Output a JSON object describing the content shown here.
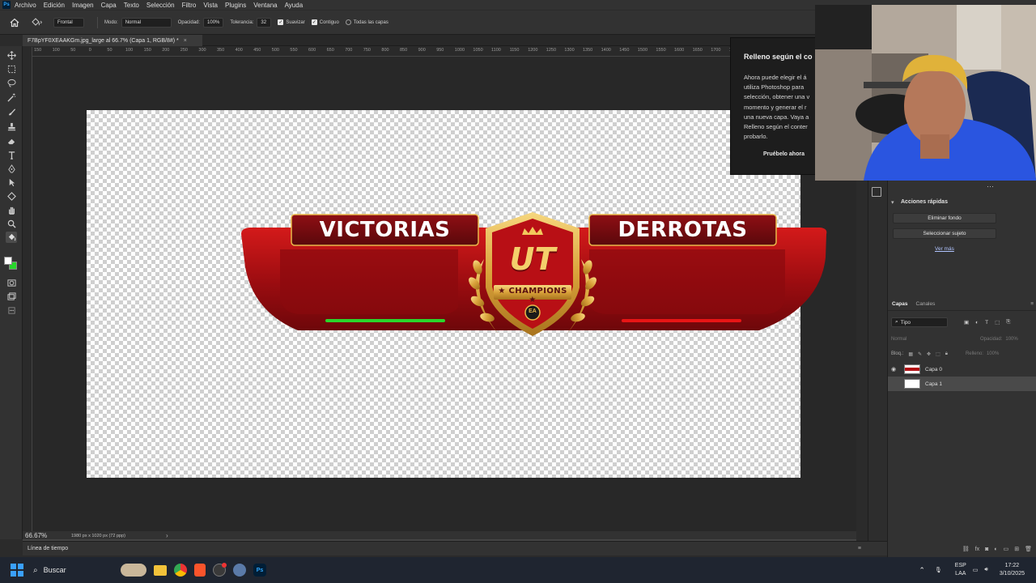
{
  "menubar": {
    "app_logo": "Ps",
    "items": [
      "Archivo",
      "Edición",
      "Imagen",
      "Capa",
      "Texto",
      "Selección",
      "Filtro",
      "Vista",
      "Plugins",
      "Ventana",
      "Ayuda"
    ]
  },
  "options": {
    "preset": "Frontal",
    "mode_label": "Modo:",
    "mode_value": "Normal",
    "opacity_label": "Opacidad:",
    "opacity_value": "100%",
    "tolerance_label": "Tolerancia:",
    "tolerance_value": "32",
    "antialias_label": "Suavizar",
    "contiguous_label": "Contiguo",
    "all_layers_label": "Todas las capas"
  },
  "document": {
    "tab_title": "F7BpYF0XEAAKGm.jpg_large al 66.7% (Capa 1, RGB/8#) *",
    "zoom": "66.67%",
    "info": "1980 px x 1020 px (72 ppp)"
  },
  "ruler": {
    "labels": [
      "150",
      "100",
      "50",
      "0",
      "50",
      "100",
      "150",
      "200",
      "250",
      "300",
      "350",
      "400",
      "450",
      "500",
      "550",
      "600",
      "650",
      "700",
      "750",
      "800",
      "850",
      "900",
      "950",
      "1000",
      "1050",
      "1100",
      "1150",
      "1200",
      "1250",
      "1300",
      "1350",
      "1400",
      "1450",
      "1500",
      "1550",
      "1600",
      "1650",
      "1700",
      "1750"
    ]
  },
  "artwork": {
    "left_label": "VICTORIAS",
    "right_label": "DERROTAS",
    "emblem_text": "UT",
    "emblem_subtext": "★ CHAMPIONS ★",
    "badge": "EA",
    "colors": {
      "red": "#b30f14",
      "gold": "#e8b84a",
      "green": "#2bd62b"
    }
  },
  "popup": {
    "title": "Relleno según el co",
    "lines": [
      "Ahora puede elegir el á",
      "utiliza Photoshop para",
      "selección, obtener una v",
      "momento y generar el r",
      "una nueva capa. Vaya a",
      "Relleno según el conter",
      "probarlo."
    ],
    "try_now": "Pruébelo ahora",
    "extra": "("
  },
  "quick_actions": {
    "title": "Acciones rápidas",
    "remove_bg": "Eliminar fondo",
    "select_subject": "Seleccionar sujeto",
    "see_more": "Ver más"
  },
  "layers_panel": {
    "tabs": [
      "Capas",
      "Canales"
    ],
    "filter_value": "Tipo",
    "blend_mode": "Normal",
    "opacity_label": "Opacidad:",
    "opacity_value": "100%",
    "lock_label": "Bloq.:",
    "fill_label": "Relleno:",
    "fill_value": "100%",
    "layers": [
      {
        "name": "Capa 0",
        "visible": true,
        "selected": false
      },
      {
        "name": "Capa 1",
        "visible": false,
        "selected": true
      }
    ]
  },
  "timeline": {
    "label": "Línea de tiempo"
  },
  "taskbar": {
    "search_placeholder": "Buscar",
    "lang": "ESP",
    "lang2": "LAA",
    "time": "17:22",
    "date": "3/10/2025"
  }
}
